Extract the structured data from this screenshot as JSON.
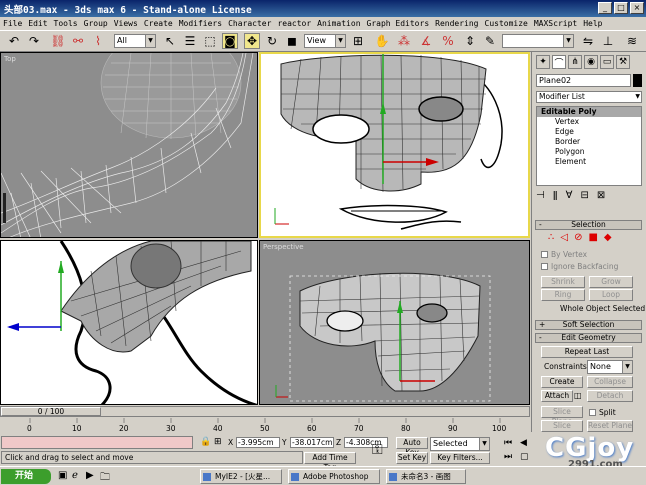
{
  "window": {
    "title": "头部03.max - 3ds max 6 - Stand-alone License"
  },
  "menu": [
    "File",
    "Edit",
    "Tools",
    "Group",
    "Views",
    "Create",
    "Modifiers",
    "Character",
    "reactor",
    "Animation",
    "Graph Editors",
    "Rendering",
    "Customize",
    "MAXScript",
    "Help"
  ],
  "toolbar": {
    "filter": "All",
    "refcoord": "View",
    "named_sel": ""
  },
  "viewports": {
    "top": "Top",
    "front": "",
    "left": "",
    "perspective": "Perspective"
  },
  "panel": {
    "object_name": "Plane02",
    "modifier_list": "Modifier List",
    "stack": {
      "header": "Editable Poly",
      "items": [
        "Vertex",
        "Edge",
        "Border",
        "Polygon",
        "Element"
      ]
    },
    "selection": {
      "title": "Selection",
      "by_vertex": "By Vertex",
      "ignore_backfacing": "Ignore Backfacing",
      "shrink": "Shrink",
      "grow": "Grow",
      "ring": "Ring",
      "loop": "Loop",
      "status": "Whole Object Selected"
    },
    "soft_selection": "Soft Selection",
    "edit_geometry": {
      "title": "Edit Geometry",
      "repeat_last": "Repeat Last",
      "constraints_label": "Constraints:",
      "constraints_value": "None",
      "create": "Create",
      "collapse": "Collapse",
      "attach": "Attach",
      "detach": "Detach",
      "slice_plane": "Slice Plane",
      "split": "Split",
      "slice": "Slice",
      "reset_plane": "Reset Plane"
    }
  },
  "timeline": {
    "frame": "0 / 100",
    "ticks": [
      "0",
      "10",
      "20",
      "30",
      "40",
      "50",
      "60",
      "70",
      "80",
      "90",
      "100"
    ]
  },
  "status": {
    "x": "-3.995cm",
    "y": "-38.017cm",
    "z": "-4.308cm",
    "prompt": "Click and drag to select and move",
    "add_time_tag": "Add Time Tag",
    "auto_key": "Auto Key",
    "set_key": "Set Key",
    "key_mode": "Selected",
    "key_filters": "Key Filters..."
  },
  "taskbar": {
    "start": "开始",
    "tasks": [
      "MyIE2 - [火星...",
      "Adobe Photoshop",
      "未命名3 - 画图"
    ]
  },
  "watermark": {
    "brand": "CGjoy",
    "url": "2991.com"
  }
}
